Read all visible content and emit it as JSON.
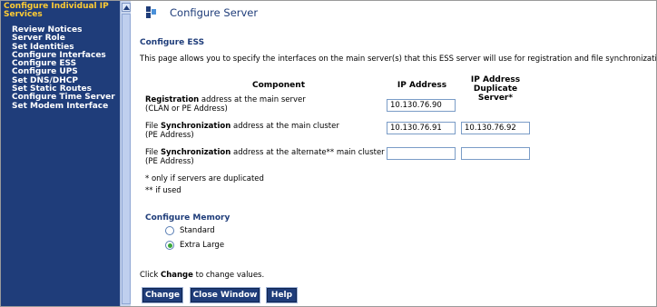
{
  "sidebar": {
    "title": "Configure Individual IP Services",
    "items": [
      "Review Notices",
      "Server Role",
      "Set Identities",
      "Configure Interfaces",
      "Configure ESS",
      "Configure UPS",
      "Set DNS/DHCP",
      "Set Static Routes",
      "Configure Time Server",
      "Set Modem Interface"
    ]
  },
  "header": {
    "title": "Configure Server"
  },
  "ess": {
    "section_title": "Configure ESS",
    "intro": "This page allows you to specify the interfaces on the main server(s) that this ESS server will use for registration and file synchronization.",
    "columns": {
      "component": "Component",
      "ip": "IP Address",
      "dup_line1": "IP Address",
      "dup_line2": "Duplicate Server*"
    },
    "rows": [
      {
        "bold": "Registration",
        "text": " address at the main server",
        "sub": "(CLAN or PE Address)",
        "ip": "10.130.76.90",
        "dup": null
      },
      {
        "pre": "File ",
        "bold": "Synchronization",
        "text": " address at the main cluster",
        "sub": "(PE Address)",
        "ip": "10.130.76.91",
        "dup": "10.130.76.92"
      },
      {
        "pre": "File ",
        "bold": "Synchronization",
        "text": " address at the alternate** main cluster",
        "sub": "(PE Address)",
        "ip": "",
        "dup": ""
      }
    ],
    "notes": [
      "* only if servers are duplicated",
      "** if used"
    ]
  },
  "memory": {
    "title": "Configure Memory",
    "options": [
      {
        "label": "Standard",
        "selected": false
      },
      {
        "label": "Extra Large",
        "selected": true
      }
    ]
  },
  "footer": {
    "pre": "Click ",
    "bold": "Change",
    "post": " to change values.",
    "buttons": {
      "change": "Change",
      "close": "Close Window",
      "help": "Help"
    }
  },
  "colors": {
    "sidebar_bg": "#1f3d7a",
    "sidebar_title": "#ffcc33",
    "accent": "#1f3d7a",
    "radio_selected": "#3aa83a"
  }
}
